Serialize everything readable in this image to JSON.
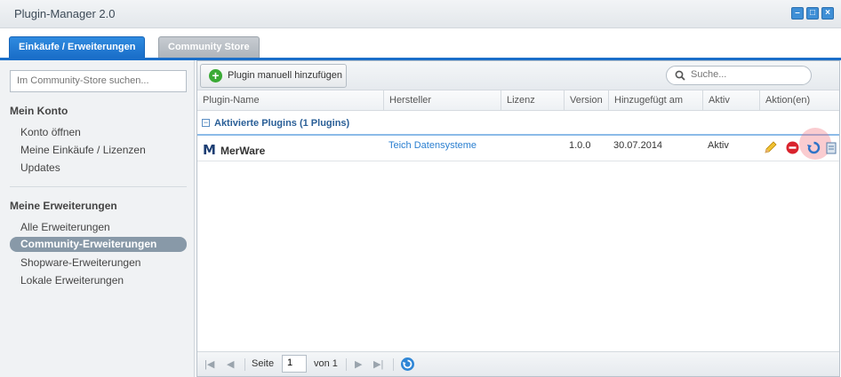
{
  "window": {
    "title": "Plugin-Manager 2.0"
  },
  "tabs": [
    {
      "label": "Einkäufe / Erweiterungen"
    },
    {
      "label": "Community Store"
    }
  ],
  "sidebar": {
    "search_placeholder": "Im Community-Store suchen...",
    "section1": {
      "title": "Mein Konto",
      "items": [
        {
          "label": "Konto öffnen"
        },
        {
          "label": "Meine Einkäufe / Lizenzen"
        },
        {
          "label": "Updates"
        }
      ]
    },
    "section2": {
      "title": "Meine Erweiterungen",
      "items": [
        {
          "label": "Alle Erweiterungen"
        },
        {
          "label": "Community-Erweiterungen"
        },
        {
          "label": "Shopware-Erweiterungen"
        },
        {
          "label": "Lokale Erweiterungen"
        }
      ]
    }
  },
  "toolbar": {
    "add_label": "Plugin manuell hinzufügen",
    "search_placeholder": "Suche..."
  },
  "grid": {
    "columns": [
      "Plugin-Name",
      "Hersteller",
      "Lizenz",
      "Version",
      "Hinzugefügt am",
      "Aktiv",
      "Aktion(en)"
    ],
    "group_label": "Aktivierte Plugins (1 Plugins)",
    "rows": [
      {
        "logo": "M",
        "name": "MerWare",
        "manufacturer": "Teich Datensysteme",
        "license": "",
        "version": "1.0.0",
        "added": "30.07.2014",
        "active": "Aktiv"
      }
    ]
  },
  "pager": {
    "page_label": "Seite",
    "page_value": "1",
    "of_label": "von 1"
  },
  "colors": {
    "accent": "#1a6ec9",
    "link": "#2a7fd0",
    "selected_bg": "#8899a8"
  }
}
